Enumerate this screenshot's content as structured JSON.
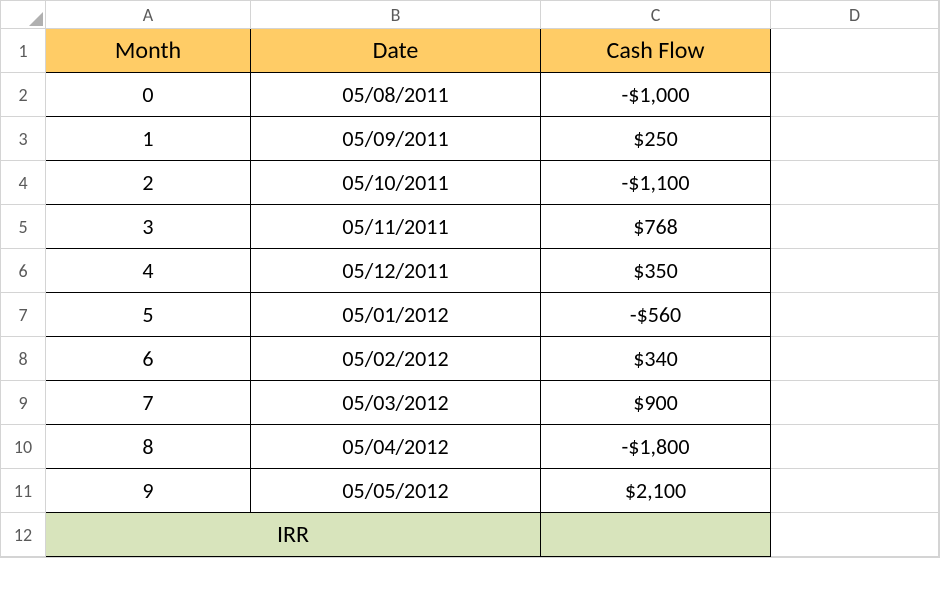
{
  "columns": [
    "A",
    "B",
    "C",
    "D"
  ],
  "row_numbers": [
    "1",
    "2",
    "3",
    "4",
    "5",
    "6",
    "7",
    "8",
    "9",
    "10",
    "11",
    "12"
  ],
  "headers": {
    "a": "Month",
    "b": "Date",
    "c": "Cash Flow"
  },
  "rows": [
    {
      "month": "0",
      "date": "05/08/2011",
      "cashflow": "-$1,000"
    },
    {
      "month": "1",
      "date": "05/09/2011",
      "cashflow": "$250"
    },
    {
      "month": "2",
      "date": "05/10/2011",
      "cashflow": "-$1,100"
    },
    {
      "month": "3",
      "date": "05/11/2011",
      "cashflow": "$768"
    },
    {
      "month": "4",
      "date": "05/12/2011",
      "cashflow": "$350"
    },
    {
      "month": "5",
      "date": "05/01/2012",
      "cashflow": "-$560"
    },
    {
      "month": "6",
      "date": "05/02/2012",
      "cashflow": "$340"
    },
    {
      "month": "7",
      "date": "05/03/2012",
      "cashflow": "$900"
    },
    {
      "month": "8",
      "date": "05/04/2012",
      "cashflow": "-$1,800"
    },
    {
      "month": "9",
      "date": "05/05/2012",
      "cashflow": "$2,100"
    }
  ],
  "footer": {
    "label": "IRR",
    "result": ""
  }
}
